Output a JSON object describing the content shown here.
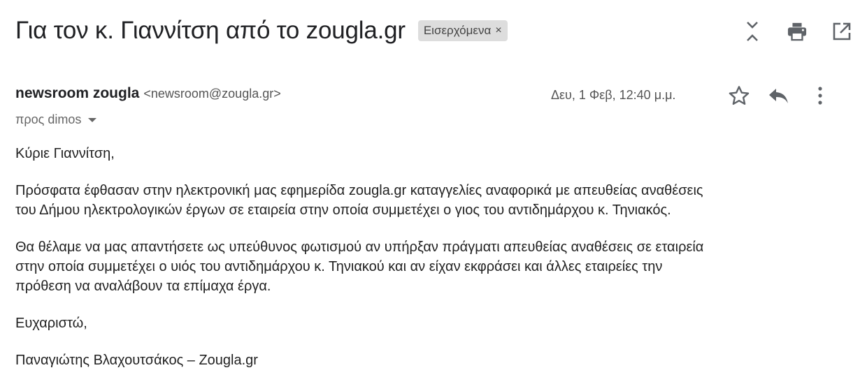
{
  "subject": "Για τον κ. Γιαννίτση από το zougla.gr",
  "label_chip": {
    "text": "Εισερχόμενα",
    "close_glyph": "×"
  },
  "toolbar": {
    "icons": [
      "collapse-icon",
      "print-icon",
      "open-new-window-icon"
    ]
  },
  "message": {
    "sender_name": "newsroom zougla",
    "sender_email": "<newsroom@zougla.gr>",
    "to": "προς dimos",
    "date": "Δευ, 1 Φεβ, 12:40 μ.μ.",
    "icons": [
      "star-icon",
      "reply-icon",
      "more-vert-icon"
    ],
    "body": {
      "greeting": "Κύριε Γιαννίτση,",
      "paragraph_1_line_1": "Πρόσφατα έφθασαν στην ηλεκτρονική μας εφημερίδα zougla.gr καταγγελίες αναφορικά με απευθείας αναθέσεις",
      "paragraph_1_line_2": "του Δήμου ηλεκτρολογικών έργων σε εταιρεία στην οποία συμμετέχει ο γιος του αντιδημάρχου κ. Τηνιακός.",
      "paragraph_2_line_1": "Θα θέλαμε να μας απαντήσετε ως υπεύθυνος φωτισμού αν υπήρξαν πράγματι απευθείας αναθέσεις σε εταιρεία",
      "paragraph_2_line_2": "στην οποία συμμετέχει ο υιός του αντιδημάρχου κ. Τηνιακού και αν είχαν εκφράσει και άλλες εταιρείες την",
      "paragraph_2_line_3": "πρόθεση να αναλάβουν τα επίμαχα έργα.",
      "thanks": "Ευχαριστώ,",
      "signature": "Παναγιώτης Βλαχουτσάκος – Zougla.gr"
    }
  },
  "colors": {
    "text": "#222222",
    "secondary": "#555555",
    "chip_bg": "#dddddd",
    "icon": "#5f6368"
  }
}
